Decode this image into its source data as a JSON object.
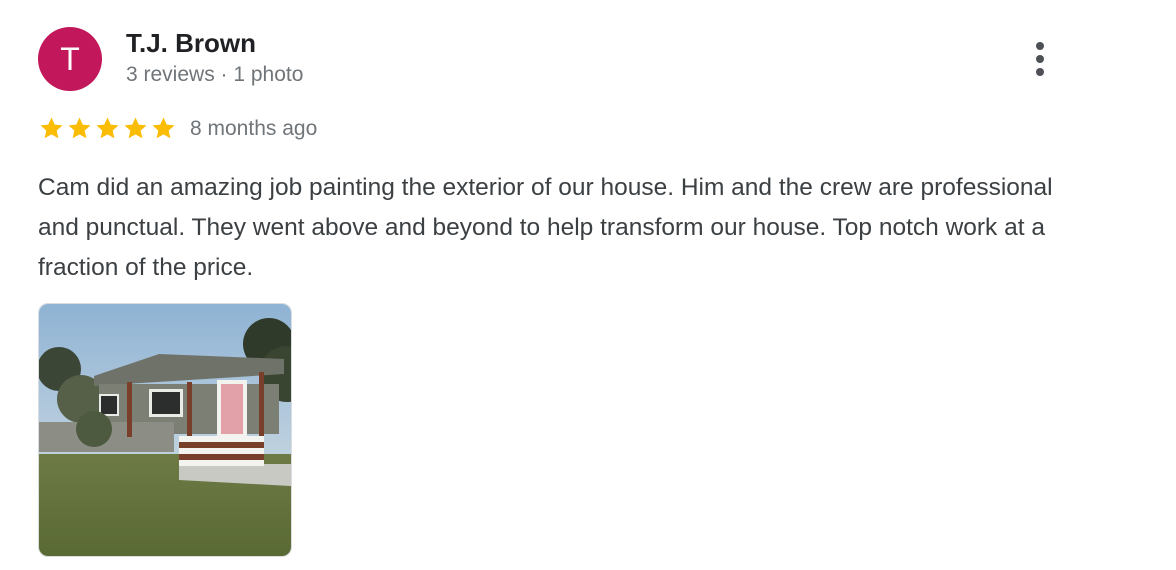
{
  "reviewer": {
    "initial": "T",
    "name": "T.J. Brown",
    "meta": "3 reviews · 1 photo",
    "avatar_color": "#c2185b"
  },
  "rating": {
    "stars": 5,
    "star_color": "#fbbc04",
    "time": "8 months ago"
  },
  "review": {
    "text": "Cam did an amazing job painting the exterior of our house. Him and the crew are professional and punctual. They went above and beyond to help transform our house. Top notch work at a fraction of the price."
  },
  "menu": {
    "icon": "more-vert-icon"
  }
}
